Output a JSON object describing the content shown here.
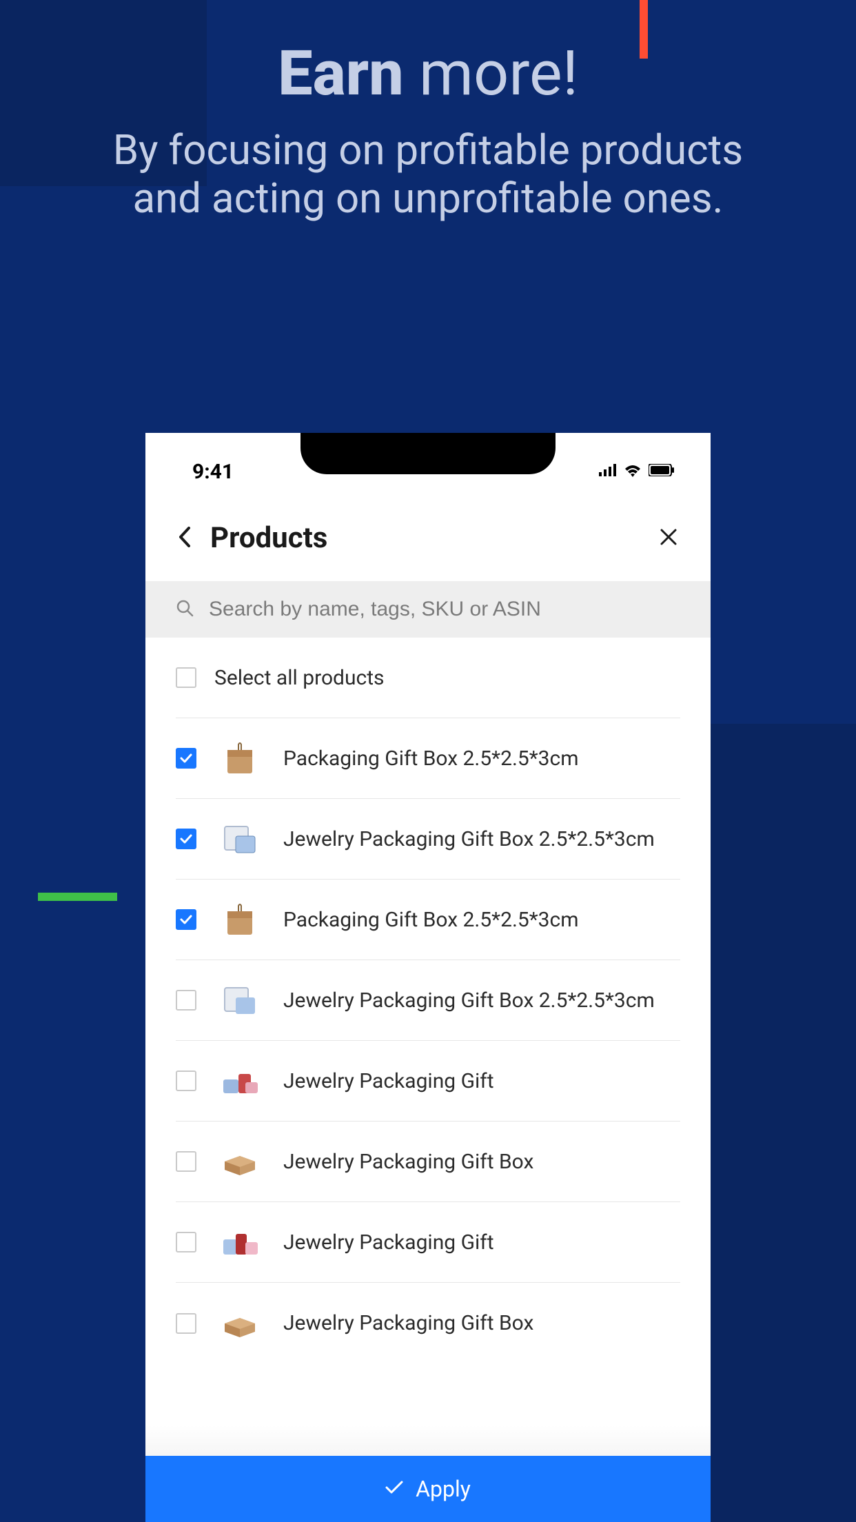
{
  "hero": {
    "title_bold": "Earn",
    "title_rest": " more!",
    "subtitle": "By focusing on profitable products and acting on unprofitable ones."
  },
  "status": {
    "time": "9:41"
  },
  "header": {
    "title": "Products"
  },
  "search": {
    "placeholder": "Search by name, tags, SKU or ASIN"
  },
  "select_all": {
    "label": "Select all products",
    "checked": false
  },
  "products": [
    {
      "name": "Packaging Gift Box 2.5*2.5*3cm",
      "checked": true,
      "thumb": "brown-box"
    },
    {
      "name": "Jewelry Packaging Gift Box 2.5*2.5*3cm",
      "checked": true,
      "thumb": "blue-box"
    },
    {
      "name": "Packaging Gift Box 2.5*2.5*3cm",
      "checked": true,
      "thumb": "brown-box"
    },
    {
      "name": "Jewelry Packaging Gift Box 2.5*2.5*3cm",
      "checked": false,
      "thumb": "blue-box"
    },
    {
      "name": "Jewelry Packaging Gift",
      "checked": false,
      "thumb": "multi-box"
    },
    {
      "name": "Jewelry Packaging Gift Box",
      "checked": false,
      "thumb": "flat-box"
    },
    {
      "name": "Jewelry Packaging Gift",
      "checked": false,
      "thumb": "multi-box-2"
    },
    {
      "name": "Jewelry Packaging Gift Box",
      "checked": false,
      "thumb": "flat-box"
    }
  ],
  "apply": {
    "label": "Apply"
  }
}
